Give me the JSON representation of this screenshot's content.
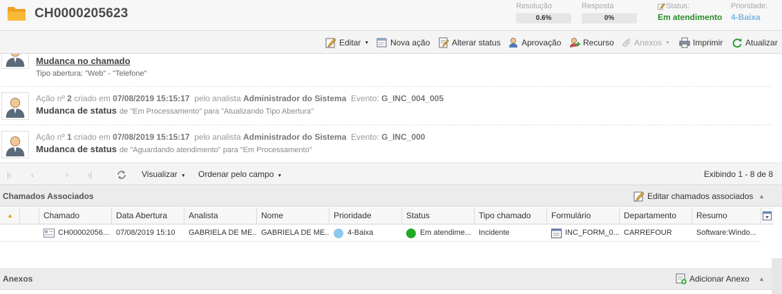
{
  "header": {
    "ticket_id": "CH0000205623",
    "resolucao_label": "Resolução",
    "resolucao_value": "0.6%",
    "resposta_label": "Resposta",
    "resposta_value": "0%",
    "status_label": "Status:",
    "status_value": "Em atendimento",
    "prioridade_label": "Prioridade:",
    "prioridade_value": "4-Baixa"
  },
  "toolbar": {
    "editar": "Editar",
    "nova_acao": "Nova ação",
    "alterar_status": "Alterar status",
    "aprovacao": "Aprovação",
    "recurso": "Recurso",
    "anexos": "Anexos",
    "imprimir": "Imprimir",
    "atualizar": "Atualizar"
  },
  "actions": [
    {
      "title": "Mudanca no chamado",
      "detail": "Tipo abertura: \"Web\" - \"Telefone\""
    },
    {
      "acao_prefix": "Ação nº",
      "num": "2",
      "criado_em": "criado em",
      "date": "07/08/2019 15:15:17",
      "pelo": "pelo analista",
      "analyst": "Administrador do Sistema",
      "evento_label": "Evento:",
      "evento": "G_INC_004_005",
      "title": "Mudanca de status",
      "subtitle": "de \"Em Processamento\" para \"Atualizando Tipo Abertura\""
    },
    {
      "acao_prefix": "Ação nº",
      "num": "1",
      "criado_em": "criado em",
      "date": "07/08/2019 15:15:17",
      "pelo": "pelo analista",
      "analyst": "Administrador do Sistema",
      "evento_label": "Evento:",
      "evento": "G_INC_000",
      "title": "Mudanca de status",
      "subtitle": "de \"Aguardando atendimento\" para \"Em Processamento\""
    }
  ],
  "pager": {
    "visualizar": "Visualizar",
    "ordenar": "Ordenar pelo campo",
    "exibindo": "Exibindo 1 - 8 de 8"
  },
  "associados": {
    "title": "Chamados Associados",
    "edit_label": "Editar chamados associados",
    "columns": [
      "Chamado",
      "Data Abertura",
      "Analista",
      "Nome",
      "Prioridade",
      "Status",
      "Tipo chamado",
      "Formulário",
      "Departamento",
      "Resumo"
    ],
    "row": {
      "chamado": "CH00002056...",
      "data": "07/08/2019 15:10",
      "analista": "GABRIELA DE ME...",
      "nome": "GABRIELA DE ME...",
      "prioridade": "4-Baixa",
      "status": "Em atendime...",
      "tipo": "Incidente",
      "formulario": "INC_FORM_0...",
      "departamento": "CARREFOUR",
      "resumo": "Software:Windo..."
    }
  },
  "anexos": {
    "title": "Anexos",
    "add_label": "Adicionar Anexo"
  },
  "colors": {
    "status_green": "#2b8a2b",
    "priority_blue": "#7cb6e0",
    "status_dot": "#22aa22",
    "priority_dot": "#8ec7f0"
  }
}
